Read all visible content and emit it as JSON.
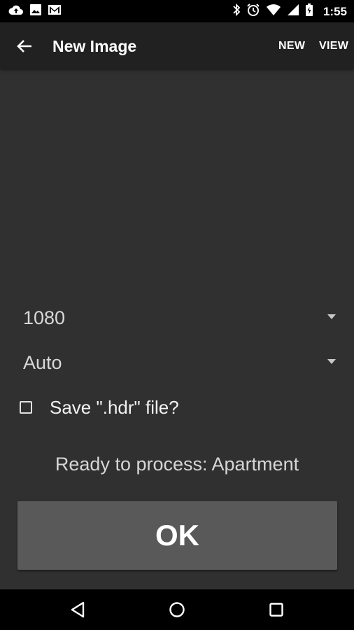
{
  "status_bar": {
    "time": "1:55",
    "left_icons": [
      "cloud-upload-icon",
      "image-icon",
      "gmail-icon"
    ],
    "right_icons": [
      "bluetooth-icon",
      "alarm-icon",
      "wifi-icon",
      "signal-icon",
      "battery-icon"
    ]
  },
  "app_bar": {
    "title": "New Image",
    "actions": {
      "new": "NEW",
      "view": "VIEW"
    }
  },
  "form": {
    "resolution": "1080",
    "mode": "Auto",
    "save_hdr": {
      "label": "Save \".hdr\" file?",
      "checked": false
    }
  },
  "status_text": "Ready to process: Apartment",
  "ok_button": "OK",
  "nav_bar": {
    "buttons": [
      "back",
      "home",
      "recents"
    ]
  }
}
